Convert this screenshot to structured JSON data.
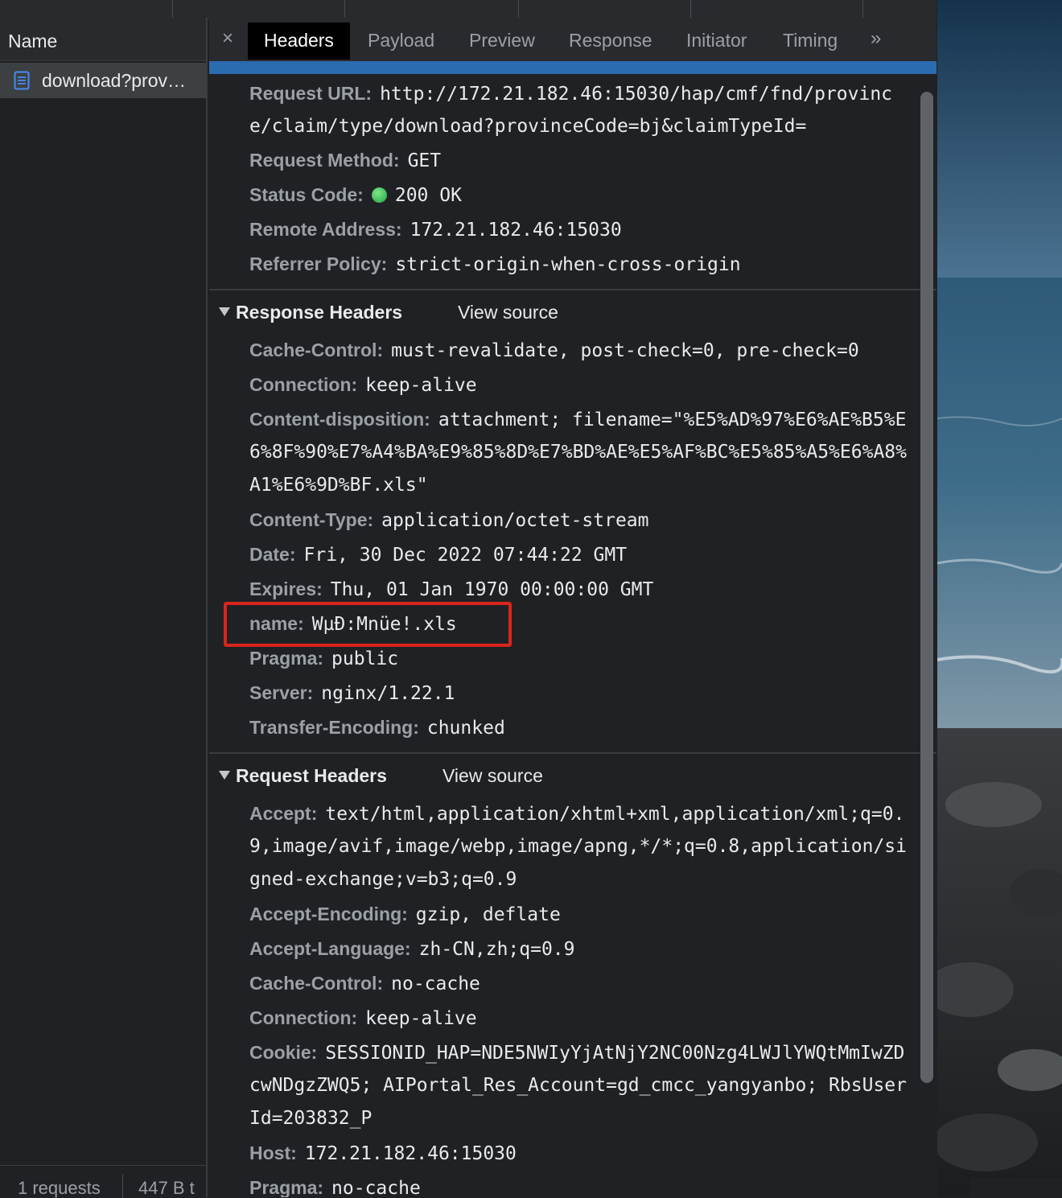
{
  "left": {
    "column_header": "Name",
    "request_name": "download?prov…",
    "status": {
      "requests": "1 requests",
      "transferred": "447 B t"
    }
  },
  "tabs": [
    "Headers",
    "Payload",
    "Preview",
    "Response",
    "Initiator",
    "Timing"
  ],
  "close_glyph": "×",
  "more_glyph": "»",
  "general": {
    "url_key": "Request URL:",
    "url_line1": "http://172.21.182.46:15030/hap/cmf/fnd/provinc",
    "url_line2": "e/claim/type/download?provinceCode=bj&claimTypeId=",
    "method_key": "Request Method:",
    "method": "GET",
    "status_key": "Status Code:",
    "status": "200 OK",
    "remote_key": "Remote Address:",
    "remote": "172.21.182.46:15030",
    "referrer_key": "Referrer Policy:",
    "referrer": "strict-origin-when-cross-origin"
  },
  "response_headers": {
    "title": "Response Headers",
    "view_source": "View source",
    "cache_key": "Cache-Control:",
    "cache": "must-revalidate, post-check=0, pre-check=0",
    "connection_key": "Connection:",
    "connection": "keep-alive",
    "cd_key": "Content-disposition:",
    "cd_line1": "attachment; filename=\"%E5%AD%97%E6%AE%B5%E",
    "cd_line2": "6%8F%90%E7%A4%BA%E9%85%8D%E7%BD%AE%E5%AF%BC%E5%85%A5%E6%A8%",
    "cd_line3": "A1%E6%9D%BF.xls\"",
    "ctype_key": "Content-Type:",
    "ctype": "application/octet-stream",
    "date_key": "Date:",
    "date": "Fri, 30 Dec 2022 07:44:22 GMT",
    "expires_key": "Expires:",
    "expires": "Thu, 01 Jan 1970 00:00:00 GMT",
    "name_key": "name:",
    "name": "WµÐ:Mnüe!.xls",
    "pragma_key": "Pragma:",
    "pragma": "public",
    "server_key": "Server:",
    "server": "nginx/1.22.1",
    "te_key": "Transfer-Encoding:",
    "te": "chunked"
  },
  "request_headers": {
    "title": "Request Headers",
    "view_source": "View source",
    "accept_key": "Accept:",
    "accept_line1": "text/html,application/xhtml+xml,application/xml;q=0.",
    "accept_line2": "9,image/avif,image/webp,image/apng,*/*;q=0.8,application/si",
    "accept_line3": "gned-exchange;v=b3;q=0.9",
    "ae_key": "Accept-Encoding:",
    "ae": "gzip, deflate",
    "al_key": "Accept-Language:",
    "al": "zh-CN,zh;q=0.9",
    "cache_key": "Cache-Control:",
    "cache": "no-cache",
    "connection_key": "Connection:",
    "connection": "keep-alive",
    "cookie_key": "Cookie:",
    "cookie_line1": "SESSIONID_HAP=NDE5NWIyYjAtNjY2NC00Nzg4LWJlYWQtMmIwZD",
    "cookie_line2": "cwNDgzZWQ5; AIPortal_Res_Account=gd_cmcc_yangyanbo; RbsUser",
    "cookie_line3": "Id=203832_P",
    "host_key": "Host:",
    "host": "172.21.182.46:15030",
    "pragma_key": "Pragma:",
    "pragma": "no-cache"
  },
  "colors": {
    "accent_blue": "#2b6bb0",
    "highlight_red": "#d9251c",
    "status_green": "#1ea446"
  }
}
